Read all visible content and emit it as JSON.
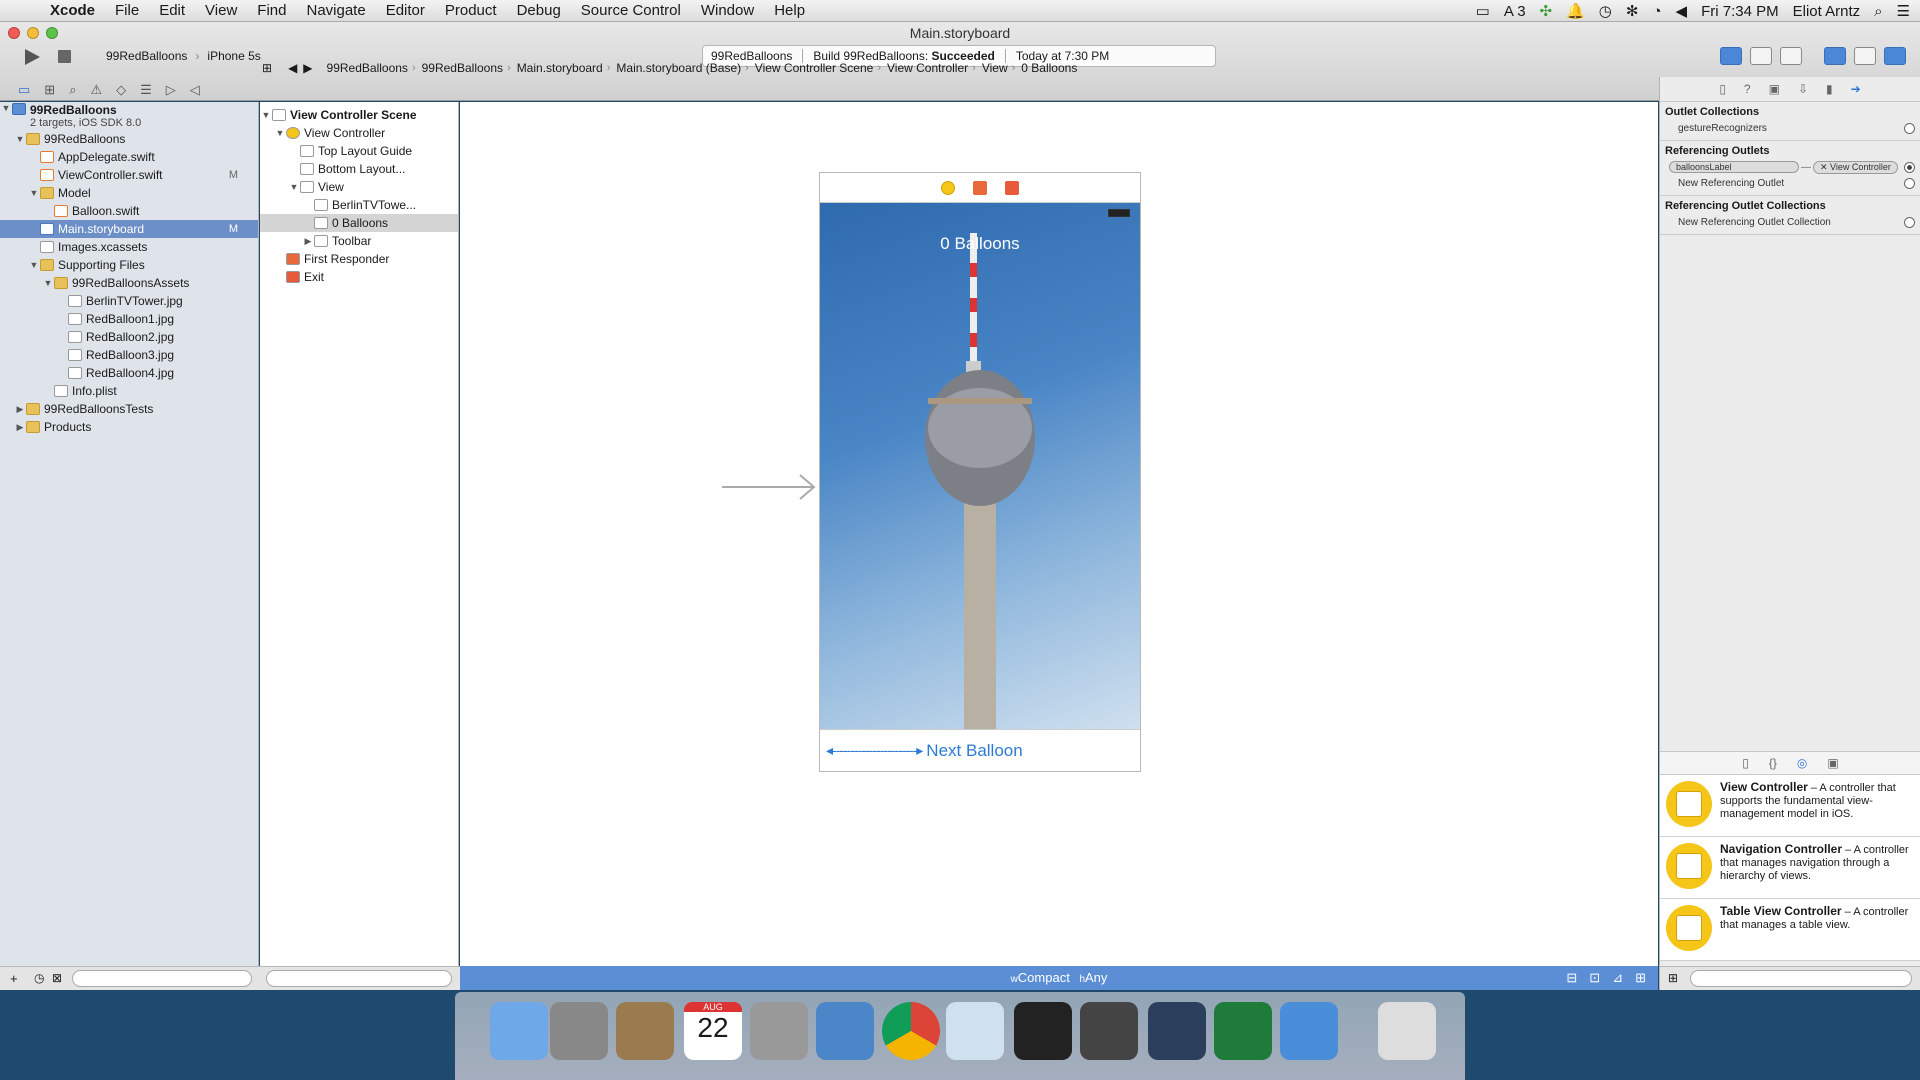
{
  "menubar": {
    "app": "Xcode",
    "items": [
      "File",
      "Edit",
      "View",
      "Find",
      "Navigate",
      "Editor",
      "Product",
      "Debug",
      "Source Control",
      "Window",
      "Help"
    ],
    "status_badge": "3",
    "clock": "Fri 7:34 PM",
    "user": "Eliot Arntz"
  },
  "window": {
    "title": "Main.storyboard",
    "scheme_target": "99RedBalloons",
    "scheme_device": "iPhone 5s",
    "activity_project": "99RedBalloons",
    "activity_build": "Build 99RedBalloons:",
    "activity_result": "Succeeded",
    "activity_time": "Today at 7:30 PM"
  },
  "jumpbar": [
    "99RedBalloons",
    "99RedBalloons",
    "Main.storyboard",
    "Main.storyboard (Base)",
    "View Controller Scene",
    "View Controller",
    "View",
    "0 Balloons"
  ],
  "navigator": {
    "project_name": "99RedBalloons",
    "project_sub": "2 targets, iOS SDK 8.0",
    "items": [
      {
        "label": "99RedBalloons",
        "level": 1,
        "kind": "folder",
        "disc": "▼"
      },
      {
        "label": "AppDelegate.swift",
        "level": 2,
        "kind": "swift"
      },
      {
        "label": "ViewController.swift",
        "level": 2,
        "kind": "swift",
        "badge": "M"
      },
      {
        "label": "Model",
        "level": 2,
        "kind": "folder",
        "disc": "▼"
      },
      {
        "label": "Balloon.swift",
        "level": 3,
        "kind": "swift"
      },
      {
        "label": "Main.storyboard",
        "level": 2,
        "kind": "sb",
        "badge": "M",
        "selected": true
      },
      {
        "label": "Images.xcassets",
        "level": 2,
        "kind": "file"
      },
      {
        "label": "Supporting Files",
        "level": 2,
        "kind": "folder",
        "disc": "▼"
      },
      {
        "label": "99RedBalloonsAssets",
        "level": 3,
        "kind": "folder",
        "disc": "▼"
      },
      {
        "label": "BerlinTVTower.jpg",
        "level": 4,
        "kind": "file"
      },
      {
        "label": "RedBalloon1.jpg",
        "level": 4,
        "kind": "file"
      },
      {
        "label": "RedBalloon2.jpg",
        "level": 4,
        "kind": "file"
      },
      {
        "label": "RedBalloon3.jpg",
        "level": 4,
        "kind": "file"
      },
      {
        "label": "RedBalloon4.jpg",
        "level": 4,
        "kind": "file"
      },
      {
        "label": "Info.plist",
        "level": 3,
        "kind": "file"
      },
      {
        "label": "99RedBalloonsTests",
        "level": 1,
        "kind": "folder",
        "disc": "▶"
      },
      {
        "label": "Products",
        "level": 1,
        "kind": "folder",
        "disc": "▶"
      }
    ]
  },
  "outline": {
    "scene": "View Controller Scene",
    "items": [
      {
        "label": "View Controller",
        "level": 1,
        "disc": "▼",
        "kind": "vc"
      },
      {
        "label": "Top Layout Guide",
        "level": 2,
        "kind": "box"
      },
      {
        "label": "Bottom Layout...",
        "level": 2,
        "kind": "box"
      },
      {
        "label": "View",
        "level": 2,
        "disc": "▼",
        "kind": "box"
      },
      {
        "label": "BerlinTVTowe...",
        "level": 3,
        "kind": "img"
      },
      {
        "label": "0 Balloons",
        "level": 3,
        "kind": "lbl",
        "selected": true
      },
      {
        "label": "Toolbar",
        "level": 3,
        "disc": "▶",
        "kind": "box"
      },
      {
        "label": "First Responder",
        "level": 1,
        "kind": "fr"
      },
      {
        "label": "Exit",
        "level": 1,
        "kind": "exit"
      }
    ]
  },
  "canvas": {
    "balloons_label": "0 Balloons",
    "next_button": "Next Balloon",
    "size_class_w": "Compact",
    "size_class_h": "Any"
  },
  "inspector": {
    "outlet_collections": "Outlet Collections",
    "gesture": "gestureRecognizers",
    "referencing_outlets": "Referencing Outlets",
    "outlet_name": "balloonsLabel",
    "outlet_target": "View Controller",
    "new_ref_outlet": "New Referencing Outlet",
    "ref_outlet_collections": "Referencing Outlet Collections",
    "new_ref_outlet_collection": "New Referencing Outlet Collection"
  },
  "library": [
    {
      "title": "View Controller",
      "desc": " – A controller that supports the fundamental view-management model in iOS."
    },
    {
      "title": "Navigation Controller",
      "desc": " – A controller that manages navigation through a hierarchy of views."
    },
    {
      "title": "Table View Controller",
      "desc": " – A controller that manages a table view."
    }
  ],
  "dock_date": "22",
  "dock_month": "AUG"
}
